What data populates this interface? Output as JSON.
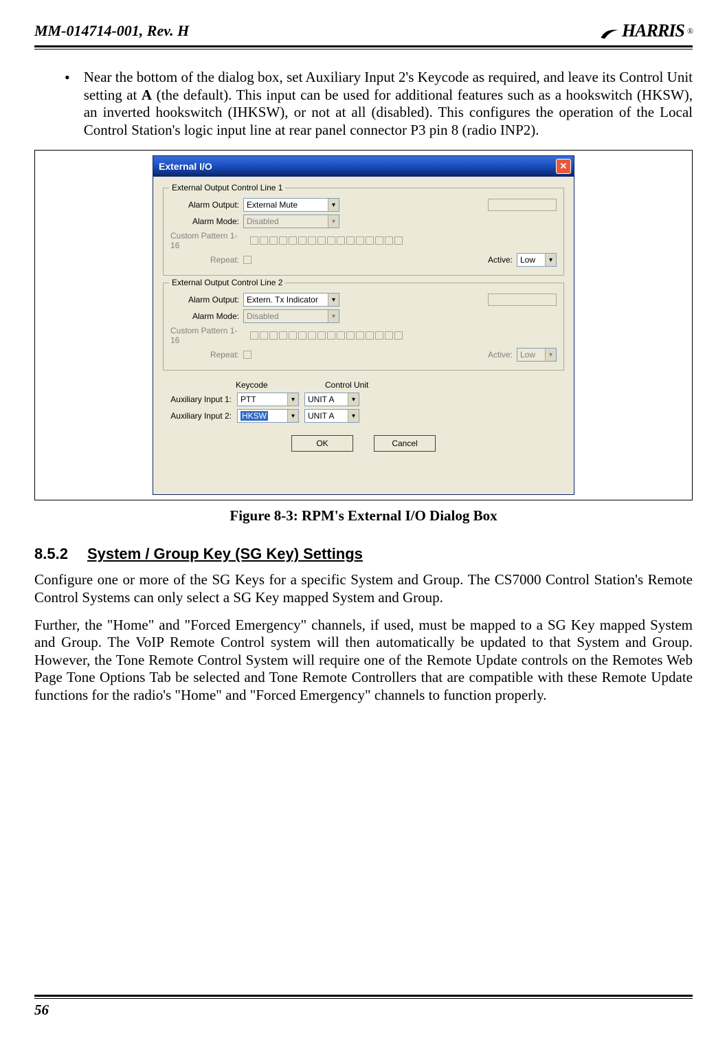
{
  "header": {
    "doc_id": "MM-014714-001, Rev. H",
    "logo_text": "HARRIS",
    "logo_reg": "®"
  },
  "bullet": {
    "text_before_bold": "Near the bottom of the dialog box, set Auxiliary Input 2's Keycode as required, and leave its Control Unit setting at ",
    "bold": "A",
    "text_after_bold": " (the default).  This input can be used for additional features such as a hookswitch (HKSW), an inverted hookswitch (IHKSW), or not at all (disabled). This configures the operation of the Local Control Station's logic input line at rear panel connector P3 pin 8 (radio INP2)."
  },
  "dialog": {
    "title": "External I/O",
    "group1": {
      "legend": "External Output Control Line 1",
      "alarm_output_label": "Alarm Output:",
      "alarm_output_value": "External Mute",
      "alarm_mode_label": "Alarm Mode:",
      "alarm_mode_value": "Disabled",
      "pattern_label": "Custom Pattern 1-16",
      "repeat_label": "Repeat:",
      "active_label": "Active:",
      "active_value": "Low"
    },
    "group2": {
      "legend": "External Output Control Line 2",
      "alarm_output_label": "Alarm Output:",
      "alarm_output_value": "Extern. Tx Indicator",
      "alarm_mode_label": "Alarm Mode:",
      "alarm_mode_value": "Disabled",
      "pattern_label": "Custom Pattern 1-16",
      "repeat_label": "Repeat:",
      "active_label": "Active:",
      "active_value": "Low"
    },
    "aux": {
      "header_keycode": "Keycode",
      "header_control": "Control Unit",
      "row1_label": "Auxiliary Input 1:",
      "row1_keycode": "PTT",
      "row1_unit": "UNIT A",
      "row2_label": "Auxiliary Input 2:",
      "row2_keycode": "HKSW",
      "row2_unit": "UNIT A"
    },
    "ok": "OK",
    "cancel": "Cancel"
  },
  "figure_caption": "Figure 8-3:  RPM's External I/O Dialog Box",
  "section": {
    "number": "8.5.2",
    "title": "System / Group Key (SG Key) Settings"
  },
  "para1": "Configure one or more of the SG Keys for a specific System and Group.  The CS7000 Control Station's Remote Control Systems can only select a SG Key mapped System and Group.",
  "para2": "Further, the \"Home\" and \"Forced Emergency\" channels, if used, must be mapped to a SG Key mapped System and Group.  The VoIP Remote Control system will then automatically be updated to that System and Group.  However, the Tone Remote Control System will require one of the Remote Update controls on the Remotes Web Page Tone Options Tab be selected and Tone Remote Controllers that are compatible with these Remote Update functions for the radio's \"Home\" and \"Forced Emergency\" channels to function properly.",
  "page_number": "56"
}
